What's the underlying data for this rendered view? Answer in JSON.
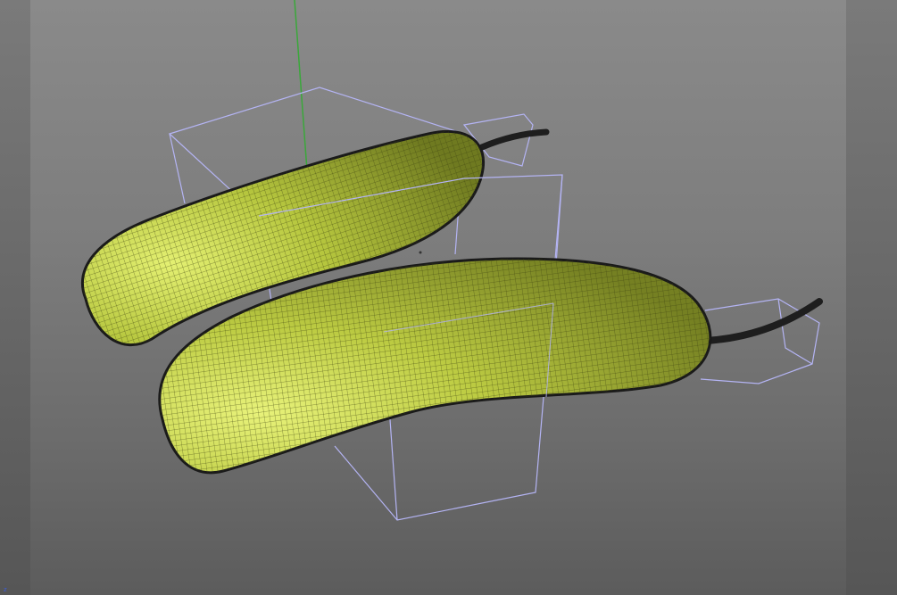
{
  "viewport": {
    "axis_indicator": "z"
  },
  "colors": {
    "background_top": "#8a8a8a",
    "background_bottom": "#5c5c5c",
    "mesh_fill": "#a8b83a",
    "mesh_highlight": "#e0ee70",
    "mesh_wire": "#3d4410",
    "outline": "#1a1a1a",
    "stem": "#1e1e1e",
    "deformer_cage": "#b4b4f4",
    "y_axis": "#3aa83a"
  },
  "objects": [
    "cucumber-back",
    "cucumber-front"
  ]
}
